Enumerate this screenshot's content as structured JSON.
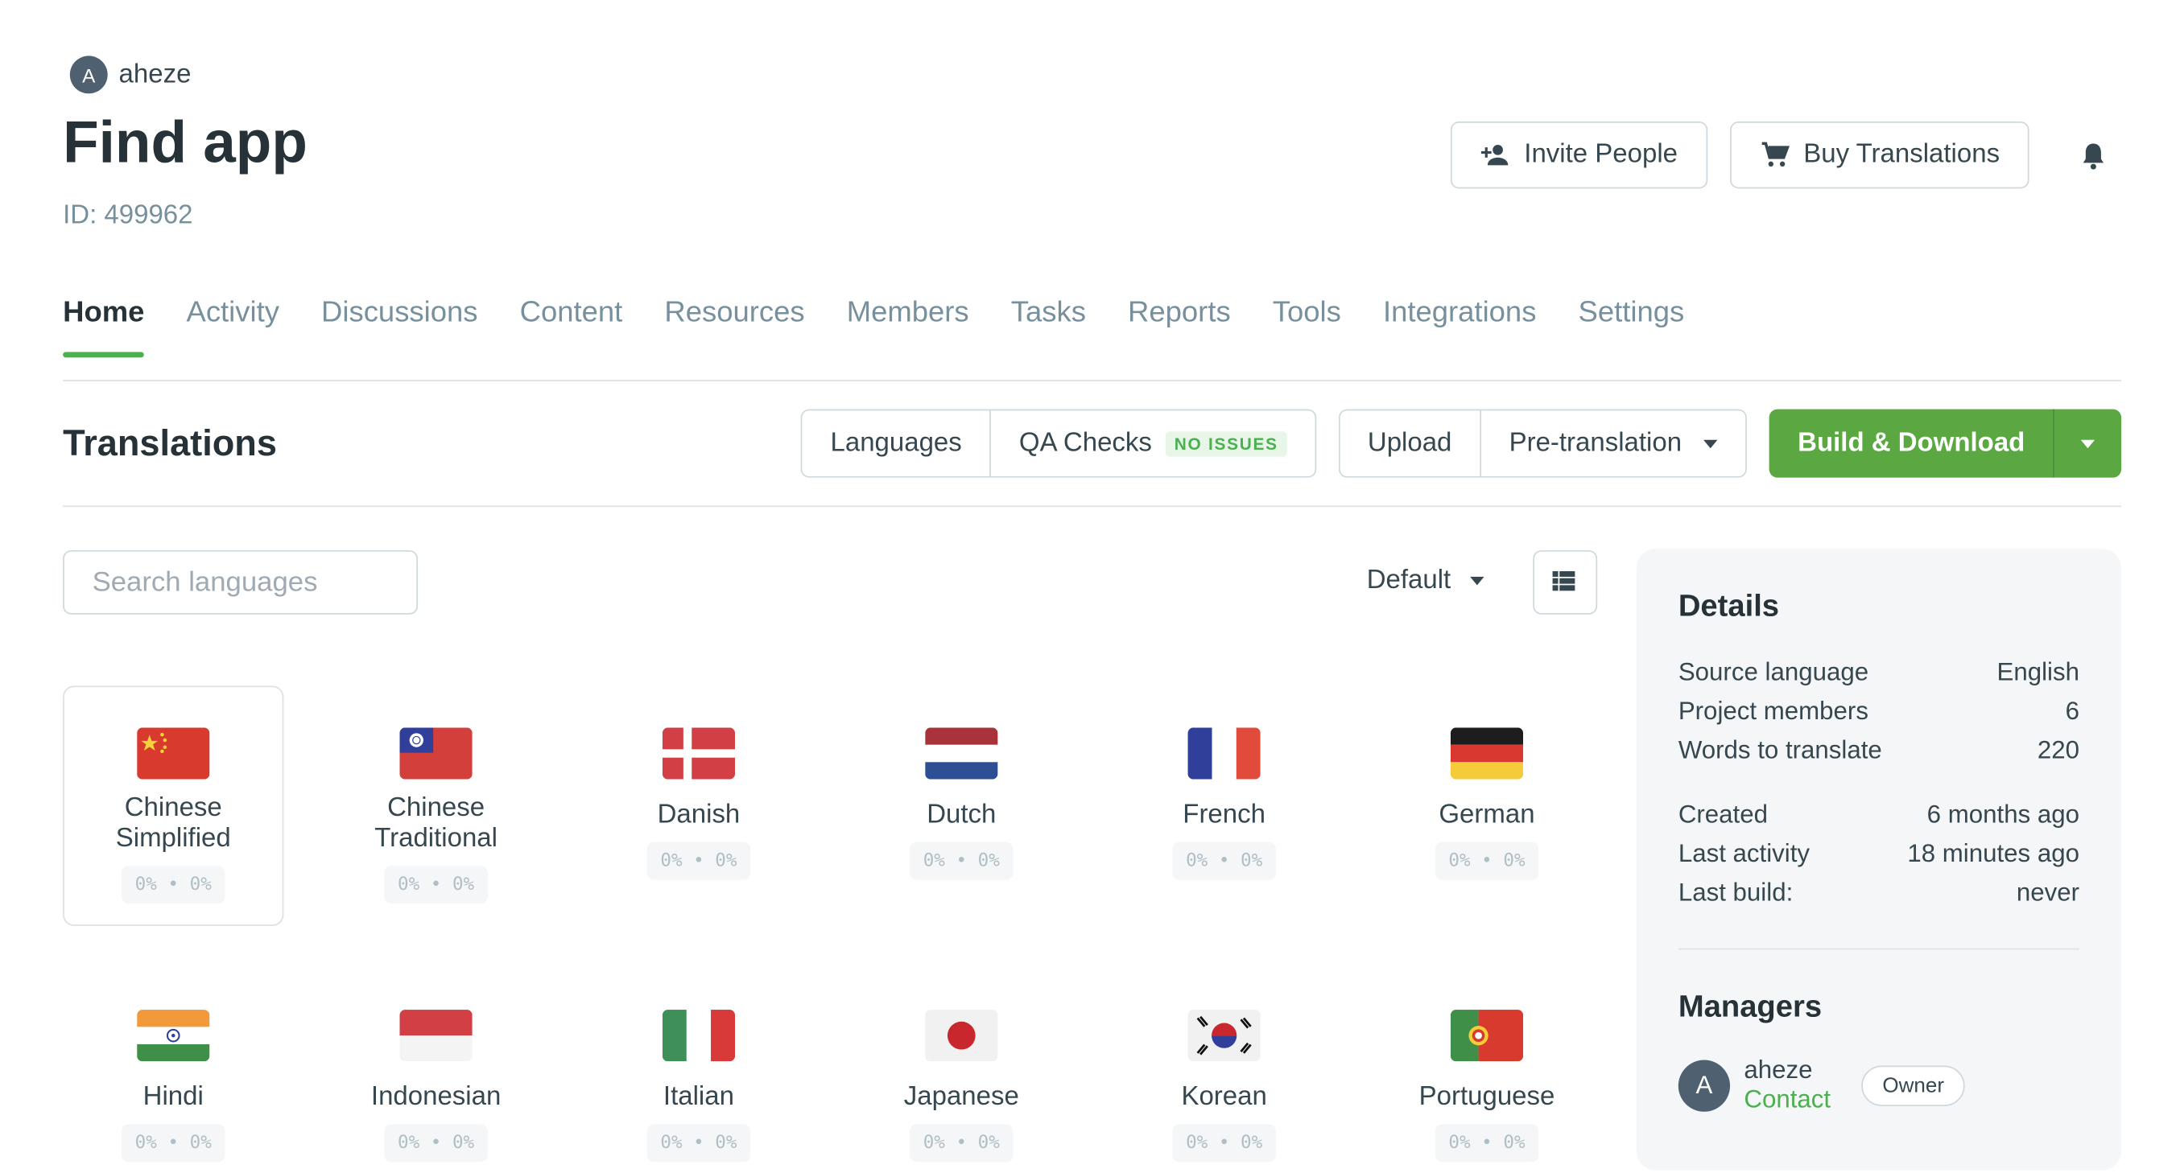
{
  "header": {
    "owner_avatar_initial": "A",
    "owner_name": "aheze",
    "project_title": "Find app",
    "project_id": "ID: 499962",
    "invite_label": "Invite People",
    "buy_label": "Buy Translations"
  },
  "tabs": [
    {
      "label": "Home"
    },
    {
      "label": "Activity"
    },
    {
      "label": "Discussions"
    },
    {
      "label": "Content"
    },
    {
      "label": "Resources"
    },
    {
      "label": "Members"
    },
    {
      "label": "Tasks"
    },
    {
      "label": "Reports"
    },
    {
      "label": "Tools"
    },
    {
      "label": "Integrations"
    },
    {
      "label": "Settings"
    }
  ],
  "active_tab": "Home",
  "translations": {
    "title": "Translations",
    "languages_label": "Languages",
    "qa_label": "QA Checks",
    "qa_badge": "NO ISSUES",
    "upload_label": "Upload",
    "pretranslation_label": "Pre-translation",
    "build_label": "Build & Download",
    "search_placeholder": "Search languages",
    "sort_value": "Default"
  },
  "languages": [
    {
      "name": "Chinese Simplified",
      "progress": "0% • 0%",
      "flag": "cn"
    },
    {
      "name": "Chinese Traditional",
      "progress": "0% • 0%",
      "flag": "tw"
    },
    {
      "name": "Danish",
      "progress": "0% • 0%",
      "flag": "dk"
    },
    {
      "name": "Dutch",
      "progress": "0% • 0%",
      "flag": "nl"
    },
    {
      "name": "French",
      "progress": "0% • 0%",
      "flag": "fr"
    },
    {
      "name": "German",
      "progress": "0% • 0%",
      "flag": "de"
    },
    {
      "name": "Hindi",
      "progress": "0% • 0%",
      "flag": "in"
    },
    {
      "name": "Indonesian",
      "progress": "0% • 0%",
      "flag": "id"
    },
    {
      "name": "Italian",
      "progress": "0% • 0%",
      "flag": "it"
    },
    {
      "name": "Japanese",
      "progress": "0% • 0%",
      "flag": "jp"
    },
    {
      "name": "Korean",
      "progress": "0% • 0%",
      "flag": "kr"
    },
    {
      "name": "Portuguese",
      "progress": "0% • 0%",
      "flag": "pt"
    }
  ],
  "details": {
    "title": "Details",
    "rows_a": [
      {
        "label": "Source language",
        "value": "English"
      },
      {
        "label": "Project members",
        "value": "6"
      },
      {
        "label": "Words to translate",
        "value": "220"
      }
    ],
    "rows_b": [
      {
        "label": "Created",
        "value": "6 months ago"
      },
      {
        "label": "Last activity",
        "value": "18 minutes ago"
      },
      {
        "label": "Last build:",
        "value": "never"
      }
    ],
    "managers_title": "Managers",
    "manager": {
      "initial": "A",
      "name": "aheze",
      "contact": "Contact",
      "role": "Owner"
    }
  },
  "colors": {
    "accent": "#5ba843",
    "text": "#263238",
    "muted": "#78909c"
  },
  "icons": [
    "add-person-icon",
    "cart-icon",
    "bell-icon",
    "caret-down-icon",
    "list-view-icon"
  ]
}
